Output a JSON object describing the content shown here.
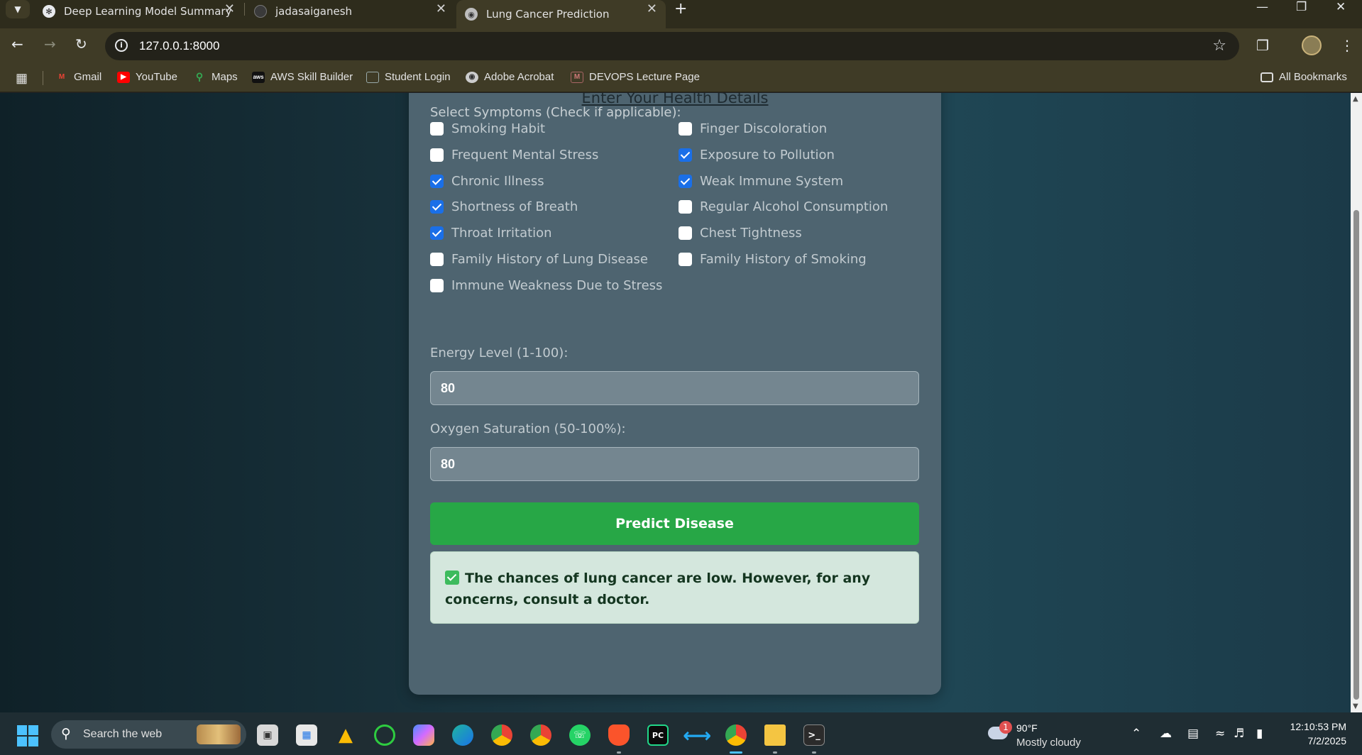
{
  "browser": {
    "tabs": [
      {
        "title": "Deep Learning Model Summary",
        "active": false
      },
      {
        "title": "jadasaiganesh",
        "active": false
      },
      {
        "title": "Lung Cancer Prediction",
        "active": true
      }
    ],
    "url": "127.0.0.1:8000",
    "bookmarks": [
      "Gmail",
      "YouTube",
      "Maps",
      "AWS Skill Builder",
      "Student Login",
      "Adobe Acrobat",
      "DEVOPS Lecture Page"
    ],
    "all_bookmarks": "All Bookmarks",
    "icons": {
      "back": "back-arrow-icon",
      "forward": "forward-arrow-icon",
      "reload": "reload-icon",
      "star": "star-icon",
      "extensions": "puzzle-icon",
      "menu": "kebab-menu-icon"
    }
  },
  "form": {
    "title": "Enter Your Health Details",
    "symptoms_label": "Select Symptoms (Check if applicable):",
    "symptoms_left": [
      {
        "label": "Smoking Habit",
        "checked": false
      },
      {
        "label": "Frequent Mental Stress",
        "checked": false
      },
      {
        "label": "Chronic Illness",
        "checked": true
      },
      {
        "label": "Shortness of Breath",
        "checked": true
      },
      {
        "label": "Throat Irritation",
        "checked": true
      },
      {
        "label": "Family History of Lung Disease",
        "checked": false
      },
      {
        "label": "Immune Weakness Due to Stress",
        "checked": false
      }
    ],
    "symptoms_right": [
      {
        "label": "Finger Discoloration",
        "checked": false
      },
      {
        "label": "Exposure to Pollution",
        "checked": true
      },
      {
        "label": "Weak Immune System",
        "checked": true
      },
      {
        "label": "Regular Alcohol Consumption",
        "checked": false
      },
      {
        "label": "Chest Tightness",
        "checked": false
      },
      {
        "label": "Family History of Smoking",
        "checked": false
      }
    ],
    "energy_label": "Energy Level (1-100):",
    "energy_value": "80",
    "oxygen_label": "Oxygen Saturation (50-100%):",
    "oxygen_value": "80",
    "predict_button": "Predict Disease",
    "result": "The chances of lung cancer are low. However, for any concerns, consult a doctor.",
    "colors": {
      "predict": "#27a746",
      "result_bg": "#d4e7dd",
      "checkbox": "#1a6fe8"
    }
  },
  "taskbar": {
    "search_placeholder": "Search the web",
    "weather_badge": "1",
    "temperature": "90°F",
    "condition": "Mostly cloudy",
    "time": "12:10:53 PM",
    "date": "7/2/2025"
  }
}
